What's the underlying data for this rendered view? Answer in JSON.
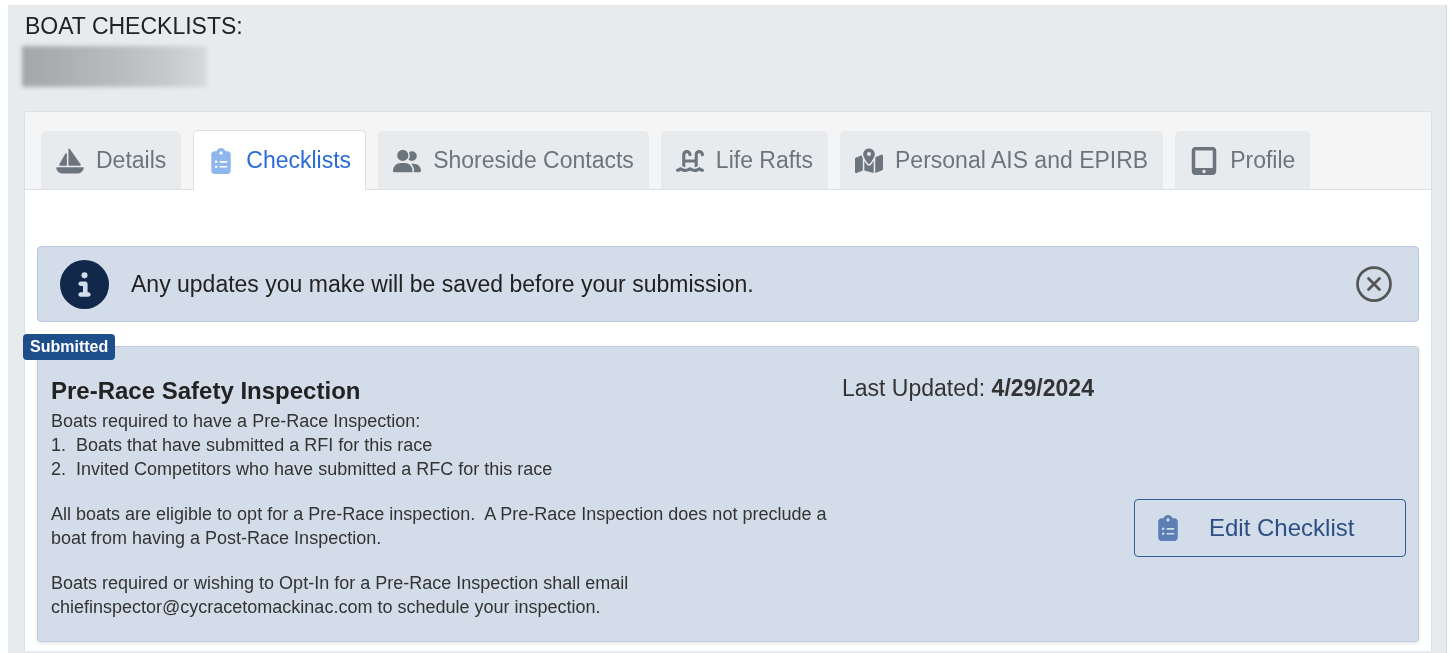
{
  "page_title": "BOAT CHECKLISTS:",
  "tabs": [
    {
      "label": "Details",
      "selected": false
    },
    {
      "label": "Checklists",
      "selected": true
    },
    {
      "label": "Shoreside Contacts",
      "selected": false
    },
    {
      "label": "Life Rafts",
      "selected": false
    },
    {
      "label": "Personal AIS and EPIRB",
      "selected": false
    },
    {
      "label": "Profile",
      "selected": false
    }
  ],
  "alert": {
    "message": "Any updates you make will be saved before your submission."
  },
  "checklists": [
    {
      "status": "Submitted",
      "title": "Pre-Race Safety Inspection",
      "last_updated": "Last Updated: **4/29/2024**",
      "paragraphs": [
        [
          "Boats required to have a Pre-Race Inspection:",
          "1.  Boats that have submitted a RFI for this race",
          "2.  Invited Competitors who have submitted a RFC for this race"
        ],
        [
          "All boats are eligible to opt for a Pre-Race inspection.  A Pre-Race Inspection does not preclude a boat from having a Post-Race Inspection."
        ],
        [
          "Boats required or wishing to Opt-In for a Pre-Race Inspection shall email chiefinspector@cycracetomackinac.com to schedule your inspection."
        ]
      ],
      "button": "Edit Checklist"
    }
  ]
}
